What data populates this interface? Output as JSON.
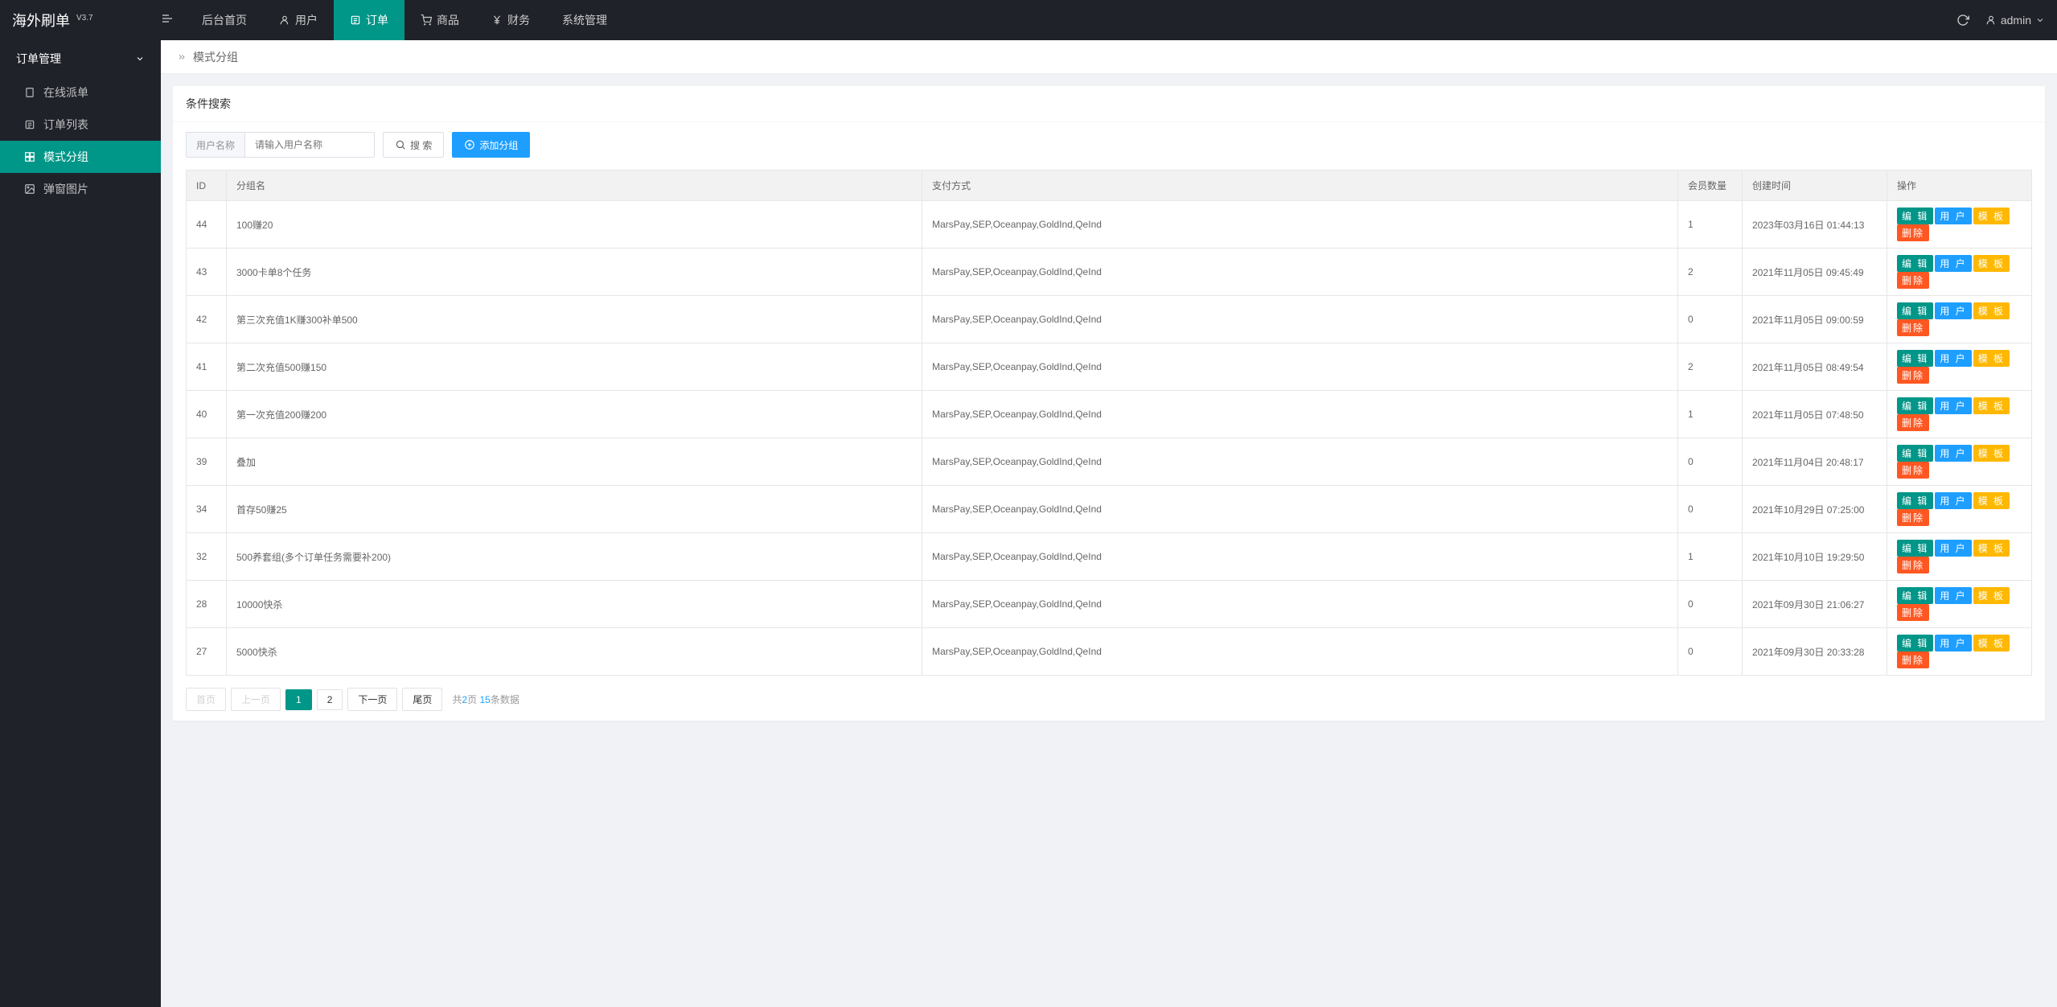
{
  "brand": {
    "name": "海外刷单",
    "version": "V3.7"
  },
  "nav": {
    "items": [
      {
        "label": "后台首页",
        "icon": null
      },
      {
        "label": "用户",
        "icon": "user"
      },
      {
        "label": "订单",
        "icon": "list",
        "active": true
      },
      {
        "label": "商品",
        "icon": "cart"
      },
      {
        "label": "财务",
        "icon": "yen"
      },
      {
        "label": "系统管理",
        "icon": null
      }
    ]
  },
  "user": {
    "name": "admin"
  },
  "sidebar": {
    "header": "订单管理",
    "items": [
      {
        "label": "在线派单",
        "icon": "page"
      },
      {
        "label": "订单列表",
        "icon": "list"
      },
      {
        "label": "模式分组",
        "icon": "group",
        "active": true
      },
      {
        "label": "弹窗图片",
        "icon": "image"
      }
    ]
  },
  "breadcrumb": {
    "current": "模式分组"
  },
  "search": {
    "title": "条件搜索",
    "field_label": "用户名称",
    "placeholder": "请输入用户名称",
    "search_btn": "搜 索",
    "add_btn": "添加分组"
  },
  "table": {
    "headers": [
      "ID",
      "分组名",
      "支付方式",
      "会员数量",
      "创建时间",
      "操作"
    ],
    "actions": {
      "edit": "编 辑",
      "user": "用 户",
      "mode": "模 板",
      "delete": "删除"
    },
    "rows": [
      {
        "id": "44",
        "name": "100赚20",
        "pay": "MarsPay,SEP,Oceanpay,GoldInd,QeInd",
        "count": "1",
        "time": "2023年03月16日 01:44:13"
      },
      {
        "id": "43",
        "name": "3000卡单8个任务",
        "pay": "MarsPay,SEP,Oceanpay,GoldInd,QeInd",
        "count": "2",
        "time": "2021年11月05日 09:45:49"
      },
      {
        "id": "42",
        "name": "第三次充值1K赚300补单500",
        "pay": "MarsPay,SEP,Oceanpay,GoldInd,QeInd",
        "count": "0",
        "time": "2021年11月05日 09:00:59"
      },
      {
        "id": "41",
        "name": "第二次充值500赚150",
        "pay": "MarsPay,SEP,Oceanpay,GoldInd,QeInd",
        "count": "2",
        "time": "2021年11月05日 08:49:54"
      },
      {
        "id": "40",
        "name": "第一次充值200赚200",
        "pay": "MarsPay,SEP,Oceanpay,GoldInd,QeInd",
        "count": "1",
        "time": "2021年11月05日 07:48:50"
      },
      {
        "id": "39",
        "name": "叠加",
        "pay": "MarsPay,SEP,Oceanpay,GoldInd,QeInd",
        "count": "0",
        "time": "2021年11月04日 20:48:17"
      },
      {
        "id": "34",
        "name": "首存50赚25",
        "pay": "MarsPay,SEP,Oceanpay,GoldInd,QeInd",
        "count": "0",
        "time": "2021年10月29日 07:25:00"
      },
      {
        "id": "32",
        "name": "500养套组(多个订单任务需要补200)",
        "pay": "MarsPay,SEP,Oceanpay,GoldInd,QeInd",
        "count": "1",
        "time": "2021年10月10日 19:29:50"
      },
      {
        "id": "28",
        "name": "10000快杀",
        "pay": "MarsPay,SEP,Oceanpay,GoldInd,QeInd",
        "count": "0",
        "time": "2021年09月30日 21:06:27"
      },
      {
        "id": "27",
        "name": "5000快杀",
        "pay": "MarsPay,SEP,Oceanpay,GoldInd,QeInd",
        "count": "0",
        "time": "2021年09月30日 20:33:28"
      }
    ]
  },
  "pagination": {
    "first": "首页",
    "prev": "上一页",
    "pages": [
      "1",
      "2"
    ],
    "current": "1",
    "next": "下一页",
    "last": "尾页",
    "total_pages": "2",
    "total_records": "15",
    "info_prefix": "共",
    "info_mid": "页 ",
    "info_suffix": "条数据"
  }
}
